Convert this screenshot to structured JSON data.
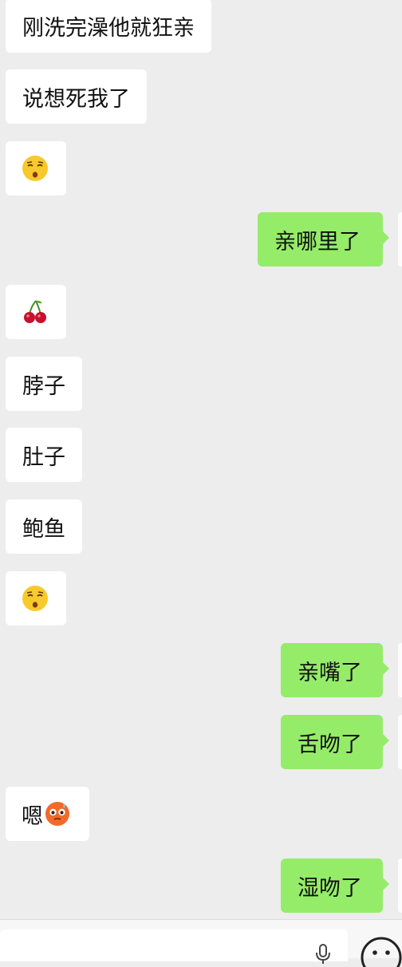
{
  "messages": [
    {
      "side": "in",
      "text": "刚洗完澡他就狂亲"
    },
    {
      "side": "in",
      "text": "说想死我了"
    },
    {
      "side": "in",
      "emoji": "shushing-face-icon"
    },
    {
      "side": "out",
      "text": "亲哪里了"
    },
    {
      "side": "in",
      "emoji": "cherries-icon"
    },
    {
      "side": "in",
      "text": "脖子"
    },
    {
      "side": "in",
      "text": "肚子"
    },
    {
      "side": "in",
      "text": "鲍鱼"
    },
    {
      "side": "in",
      "emoji": "shushing-face-icon"
    },
    {
      "side": "out",
      "text": "亲嘴了"
    },
    {
      "side": "out",
      "text": "舌吻了"
    },
    {
      "side": "in",
      "text": "嗯",
      "emoji": "flushed-face-icon"
    },
    {
      "side": "out",
      "text": "湿吻了"
    }
  ],
  "colors": {
    "background": "#ededed",
    "incoming_bubble": "#ffffff",
    "outgoing_bubble": "#95ec69",
    "text": "#111111"
  },
  "input_bar": {
    "voice_icon": "microphone-icon",
    "emoji_icon": "emoji-face-icon"
  }
}
